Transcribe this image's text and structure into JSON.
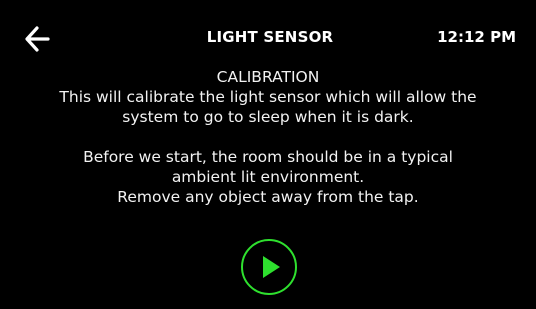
{
  "header": {
    "back_icon": "arrow-left-icon",
    "title": "LIGHT SENSOR",
    "time": "12:12 PM"
  },
  "main": {
    "heading": "CALIBRATION",
    "description_line1": "This will calibrate the light sensor which will allow the",
    "description_line2": "system to go to sleep when it is dark.",
    "instruction_line1": "Before we start, the room should be in a typical",
    "instruction_line2": "ambient lit environment.",
    "instruction_line3": "Remove any object away from the tap."
  },
  "controls": {
    "play_icon": "play-icon",
    "accent_color": "#2ee02e"
  }
}
